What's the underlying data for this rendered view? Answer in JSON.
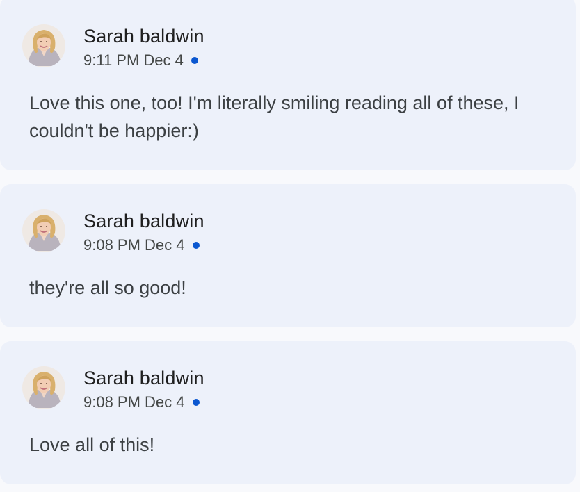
{
  "messages": [
    {
      "author": "Sarah baldwin",
      "time": "9:11 PM Dec 4",
      "text": "Love this one, too! I'm literally smiling reading all of these, I couldn't be happier:)"
    },
    {
      "author": "Sarah baldwin",
      "time": "9:08 PM Dec 4",
      "text": "they're all so good!"
    },
    {
      "author": "Sarah baldwin",
      "time": "9:08 PM Dec 4",
      "text": "Love all of this!"
    }
  ],
  "colors": {
    "card_bg": "#edf1fa",
    "unread_dot": "#0b57d0",
    "name_text": "#1f1f1f",
    "body_text": "#3c4043"
  },
  "icons": {
    "unread": "unread-dot-icon",
    "avatar": "avatar"
  }
}
